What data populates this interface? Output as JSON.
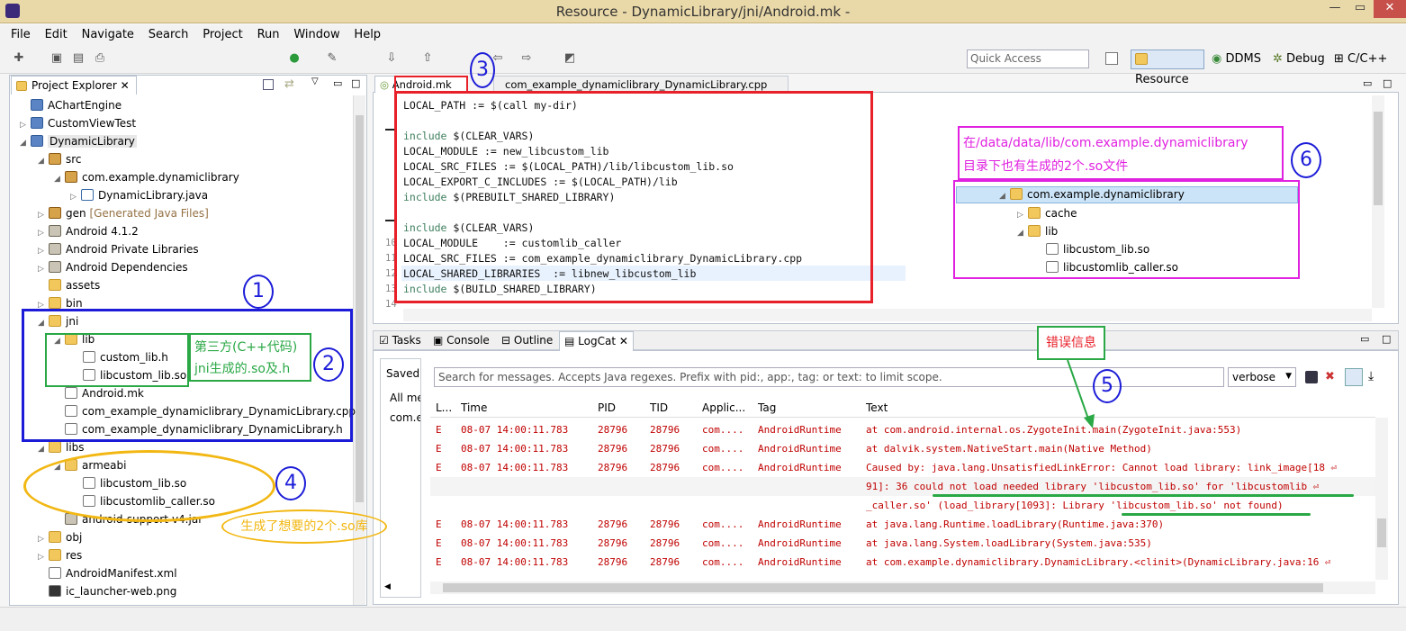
{
  "window": {
    "title": "Resource - DynamicLibrary/jni/Android.mk -",
    "minimize": "—",
    "maximize": "▭",
    "close": "✕"
  },
  "menu": [
    "File",
    "Edit",
    "Navigate",
    "Search",
    "Project",
    "Run",
    "Window",
    "Help"
  ],
  "toolbar": {
    "quick_access_placeholder": "Quick Access"
  },
  "perspectives": [
    "Resource",
    "DDMS",
    "Debug",
    "C/C++"
  ],
  "explorer": {
    "title": "Project Explorer",
    "items": [
      {
        "label": "AChartEngine"
      },
      {
        "label": "CustomViewTest"
      },
      {
        "label": "DynamicLibrary"
      },
      {
        "label": "src"
      },
      {
        "label": "com.example.dynamiclibrary"
      },
      {
        "label": "DynamicLibrary.java"
      },
      {
        "label": "gen",
        "extra": "[Generated Java Files]"
      },
      {
        "label": "Android 4.1.2"
      },
      {
        "label": "Android Private Libraries"
      },
      {
        "label": "Android Dependencies"
      },
      {
        "label": "assets"
      },
      {
        "label": "bin"
      },
      {
        "label": "jni"
      },
      {
        "label": "lib"
      },
      {
        "label": "custom_lib.h"
      },
      {
        "label": "libcustom_lib.so"
      },
      {
        "label": "Android.mk"
      },
      {
        "label": "com_example_dynamiclibrary_DynamicLibrary.cpp"
      },
      {
        "label": "com_example_dynamiclibrary_DynamicLibrary.h"
      },
      {
        "label": "libs"
      },
      {
        "label": "armeabi"
      },
      {
        "label": "libcustom_lib.so"
      },
      {
        "label": "libcustomlib_caller.so"
      },
      {
        "label": "android-support-v4.jar"
      },
      {
        "label": "obj"
      },
      {
        "label": "res"
      },
      {
        "label": "AndroidManifest.xml"
      },
      {
        "label": "ic_launcher-web.png"
      }
    ]
  },
  "editor": {
    "tabs": [
      "Android.mk",
      "com_example_dynamiclibrary_DynamicLibrary.cpp"
    ],
    "line_numbers": [
      "10",
      "11",
      "12",
      "13",
      "14"
    ],
    "lines": [
      {
        "kw": "",
        "text": "LOCAL_PATH := $(call my-dir)"
      },
      {
        "kw": "",
        "text": ""
      },
      {
        "kw": "include",
        "text": " $(CLEAR_VARS)"
      },
      {
        "kw": "",
        "text": "LOCAL_MODULE := new_libcustom_lib"
      },
      {
        "kw": "",
        "text": "LOCAL_SRC_FILES := $(LOCAL_PATH)/lib/libcustom_lib.so"
      },
      {
        "kw": "",
        "text": "LOCAL_EXPORT_C_INCLUDES := $(LOCAL_PATH)/lib"
      },
      {
        "kw": "include",
        "text": " $(PREBUILT_SHARED_LIBRARY)"
      },
      {
        "kw": "",
        "text": ""
      },
      {
        "kw": "include",
        "text": " $(CLEAR_VARS)"
      },
      {
        "kw": "",
        "text": "LOCAL_MODULE    := customlib_caller"
      },
      {
        "kw": "",
        "text": "LOCAL_SRC_FILES := com_example_dynamiclibrary_DynamicLibrary.cpp"
      },
      {
        "kw": "",
        "text": "LOCAL_SHARED_LIBRARIES  := libnew_libcustom_lib"
      },
      {
        "kw": "include",
        "text": " $(BUILD_SHARED_LIBRARY)"
      }
    ]
  },
  "device_tree": {
    "items": [
      {
        "label": "com.example.dynamiclibrary"
      },
      {
        "label": "cache"
      },
      {
        "label": "lib"
      },
      {
        "label": "libcustom_lib.so"
      },
      {
        "label": "libcustomlib_caller.so"
      }
    ]
  },
  "bottom": {
    "tabs": [
      "Tasks",
      "Console",
      "Outline",
      "LogCat"
    ],
    "saved_label": "Saved",
    "all_messages": "All me",
    "filter_item": "com.e",
    "search_placeholder": "Search for messages. Accepts Java regexes. Prefix with pid:, app:, tag: or text: to limit scope.",
    "level": "verbose",
    "columns": [
      "L...",
      "Time",
      "PID",
      "TID",
      "Applic...",
      "Tag",
      "Text"
    ],
    "rows": [
      {
        "level": "E",
        "time": "08-07 14:00:11.783",
        "pid": "28796",
        "tid": "28796",
        "app": "com....",
        "tag": "AndroidRuntime",
        "text": "at com.android.internal.os.ZygoteInit.main(ZygoteInit.java:553)"
      },
      {
        "level": "E",
        "time": "08-07 14:00:11.783",
        "pid": "28796",
        "tid": "28796",
        "app": "com....",
        "tag": "AndroidRuntime",
        "text": "at dalvik.system.NativeStart.main(Native Method)"
      },
      {
        "level": "E",
        "time": "08-07 14:00:11.783",
        "pid": "28796",
        "tid": "28796",
        "app": "com....",
        "tag": "AndroidRuntime",
        "text": "Caused by: java.lang.UnsatisfiedLinkError: Cannot load library: link_image[18 ⏎"
      },
      {
        "level": "",
        "time": "",
        "pid": "",
        "tid": "",
        "app": "",
        "tag": "",
        "text": "91]:    36 could not load needed library 'libcustom_lib.so' for 'libcustomlib ⏎"
      },
      {
        "level": "",
        "time": "",
        "pid": "",
        "tid": "",
        "app": "",
        "tag": "",
        "text": "_caller.so' (load_library[1093]: Library 'libcustom_lib.so' not found)"
      },
      {
        "level": "E",
        "time": "08-07 14:00:11.783",
        "pid": "28796",
        "tid": "28796",
        "app": "com....",
        "tag": "AndroidRuntime",
        "text": "at java.lang.Runtime.loadLibrary(Runtime.java:370)"
      },
      {
        "level": "E",
        "time": "08-07 14:00:11.783",
        "pid": "28796",
        "tid": "28796",
        "app": "com....",
        "tag": "AndroidRuntime",
        "text": "at java.lang.System.loadLibrary(System.java:535)"
      },
      {
        "level": "E",
        "time": "08-07 14:00:11.783",
        "pid": "28796",
        "tid": "28796",
        "app": "com....",
        "tag": "AndroidRuntime",
        "text": "at com.example.dynamiclibrary.DynamicLibrary.<clinit>(DynamicLibrary.java:16 ⏎"
      }
    ]
  },
  "annotations": {
    "n1": "1",
    "n2": "2",
    "n3": "3",
    "n4": "4",
    "n5": "5",
    "n6": "6",
    "third_party_1": "第三方(C++代码)",
    "third_party_2": "jni生成的.so及.h",
    "generated_libs": "生成了想要的2个.so库",
    "error_info": "错误信息",
    "device_note_1": "在/data/data/lib/com.example.dynamiclibrary",
    "device_note_2": "目录下也有生成的2个.so文件"
  },
  "colors": {
    "title_bg": "#e9d8a8",
    "red_box": "#e8202a",
    "blue_box": "#1c1cd8",
    "green_box": "#2aa845",
    "orange": "#f2b712",
    "magenta": "#e021e0",
    "error_text": "#c00000"
  }
}
